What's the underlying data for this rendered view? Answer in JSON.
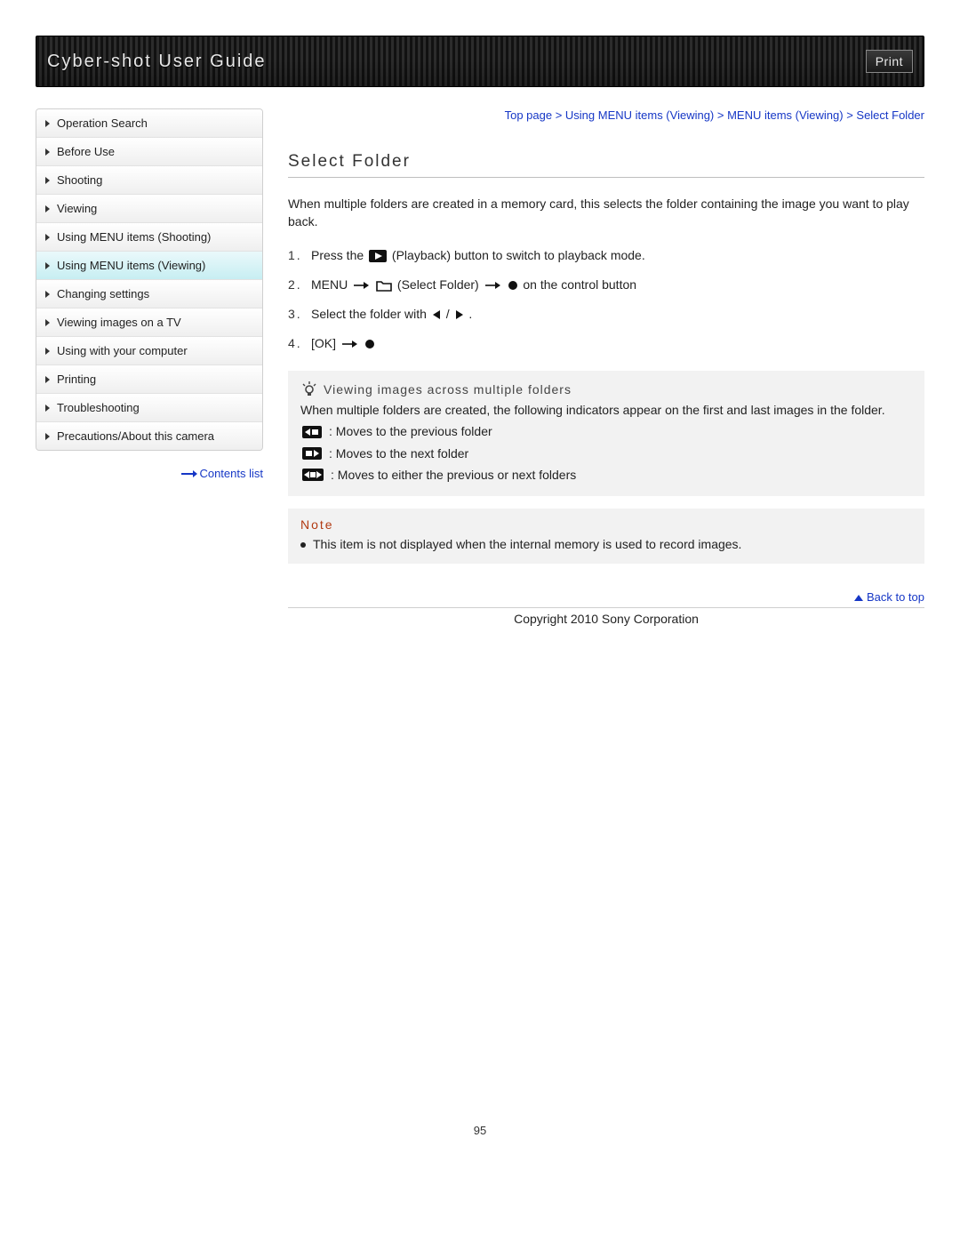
{
  "header": {
    "title": "Cyber-shot User Guide",
    "print_label": "Print"
  },
  "sidebar": {
    "items": [
      {
        "label": "Operation Search",
        "active": false
      },
      {
        "label": "Before Use",
        "active": false
      },
      {
        "label": "Shooting",
        "active": false
      },
      {
        "label": "Viewing",
        "active": false
      },
      {
        "label": "Using MENU items (Shooting)",
        "active": false
      },
      {
        "label": "Using MENU items (Viewing)",
        "active": true
      },
      {
        "label": "Changing settings",
        "active": false
      },
      {
        "label": "Viewing images on a TV",
        "active": false
      },
      {
        "label": "Using with your computer",
        "active": false
      },
      {
        "label": "Printing",
        "active": false
      },
      {
        "label": "Troubleshooting",
        "active": false
      },
      {
        "label": "Precautions/About this camera",
        "active": false
      }
    ],
    "contents_link": "Contents list"
  },
  "breadcrumb": "Top page > Using MENU items (Viewing) > MENU items (Viewing) > Select Folder",
  "title": "Select Folder",
  "intro": "When multiple folders are created in a memory card, this selects the folder containing the image you want to play back.",
  "steps": {
    "s1a": "Press the ",
    "s1b": " (Playback) button to switch to playback mode.",
    "s2a": "MENU ",
    "s2b": " (Select Folder) ",
    "s2c": " on the control button",
    "s3a": "Select the folder with ",
    "s3b": " / ",
    "s3c": " .",
    "s4a": "[OK] "
  },
  "tip": {
    "title": "Viewing images across multiple folders",
    "body": "When multiple folders are created, the following indicators appear on the first and last images in the folder.",
    "line1": ": Moves to the previous folder",
    "line2": ": Moves to the next folder",
    "line3": ": Moves to either the previous or next folders"
  },
  "note": {
    "title": "Note",
    "item": "This item is not displayed when the internal memory is used to record images."
  },
  "back_to_top": "Back to top",
  "copyright": "Copyright 2010 Sony Corporation",
  "page_number": "95"
}
